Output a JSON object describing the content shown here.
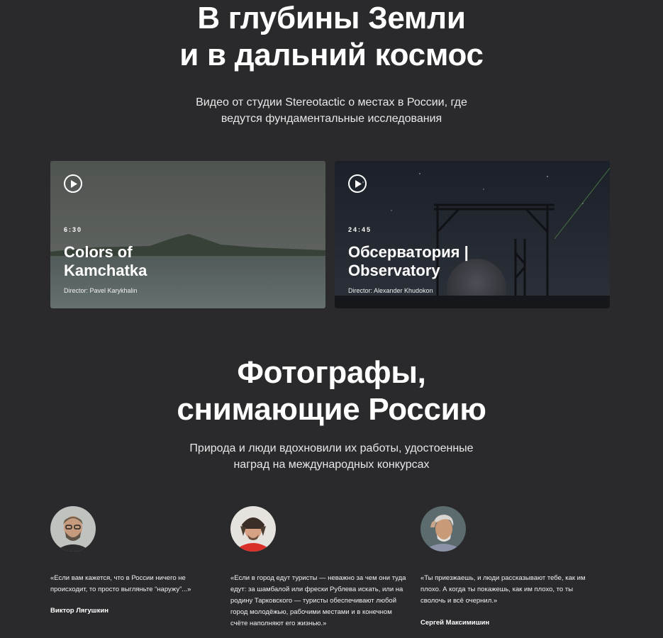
{
  "hero": {
    "title": [
      "В глубины Земли",
      "и в дальний космос"
    ],
    "subtitle": [
      "Видео от студии Stereotactic о местах в России, где",
      "ведутся фундаментальные исследования"
    ]
  },
  "videos": [
    {
      "duration": "6:30",
      "title": [
        "Colors of",
        "Kamchatka"
      ],
      "director": "Director: Pavel Karykhalin",
      "icon": "play-icon"
    },
    {
      "duration": "24:45",
      "title": [
        "Обсерватория |",
        "Observatory"
      ],
      "director": "Director: Alexander Khudokon",
      "icon": "play-icon"
    }
  ],
  "photographers_section": {
    "title": [
      "Фотографы,",
      "снимающие Россию"
    ],
    "subtitle": [
      "Природа и люди вдохновили их работы, удостоенные",
      "наград на международных конкурсах"
    ]
  },
  "photographers": [
    {
      "quote": [
        "«Если вам кажется, что в России ничего не",
        "происходит, то просто выгляньте “наружу”...»"
      ],
      "name": "Виктор Лягушкин"
    },
    {
      "quote": [
        "«Если в город едут туристы — неважно за чем они туда",
        "едут: за шамбалой или фрески Рублева искать, или на",
        "родину Тарковского — туристы обеспечивают любой",
        "город молодёжью, рабочими местами и в конечном",
        "счёте наполняют его жизнью.»"
      ],
      "name": ""
    },
    {
      "quote": [
        "«Ты приезжаешь, и люди рассказывают тебе, как им",
        "плохо. А когда ты покажешь, как им плохо, то ты",
        "сволочь и всё очернил.»"
      ],
      "name": "Сергей Максимишин"
    }
  ],
  "colors": {
    "background": "#2a2a2d",
    "text": "#ffffff"
  }
}
